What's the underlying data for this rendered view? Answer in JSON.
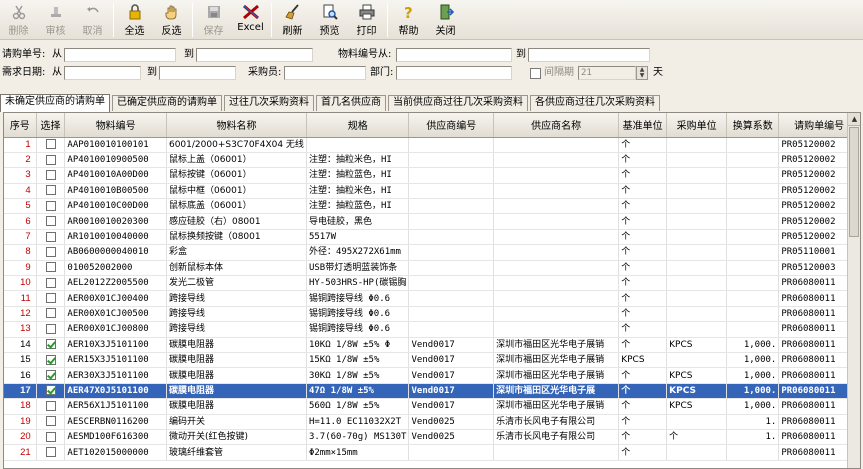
{
  "toolbar": {
    "buttons": [
      {
        "label": "删除",
        "icon": "scissors-icon",
        "enabled": false
      },
      {
        "label": "审核",
        "icon": "stamp-icon",
        "enabled": false
      },
      {
        "label": "取消",
        "icon": "undo-icon",
        "enabled": false
      },
      {
        "label": "全选",
        "icon": "lock-icon",
        "enabled": true
      },
      {
        "label": "反选",
        "icon": "hand-icon",
        "enabled": true
      },
      {
        "label": "保存",
        "icon": "save-icon",
        "enabled": false
      },
      {
        "label": "Excel",
        "icon": "excel-icon",
        "enabled": true
      },
      {
        "label": "刷新",
        "icon": "broom-icon",
        "enabled": true
      },
      {
        "label": "预览",
        "icon": "preview-icon",
        "enabled": true
      },
      {
        "label": "打印",
        "icon": "printer-icon",
        "enabled": true
      },
      {
        "label": "帮助",
        "icon": "help-icon",
        "enabled": true
      },
      {
        "label": "关闭",
        "icon": "exit-icon",
        "enabled": true
      }
    ]
  },
  "filter": {
    "req_no_label": "请购单号:",
    "from_label": "从",
    "to_label": "到",
    "material_no_label": "物料编号从:",
    "material_to_label": "到",
    "need_date_label": "需求日期:",
    "date_from_label": "从",
    "date_to_label": "到",
    "buyer_label": "采购员:",
    "dept_label": "部门:",
    "interval_label": "间隔期",
    "interval_value": "21",
    "days_label": "天"
  },
  "tabs": [
    {
      "label": "未确定供应商的请购单",
      "active": true
    },
    {
      "label": "已确定供应商的请购单",
      "active": false
    },
    {
      "label": "过往几次采购资料",
      "active": false
    },
    {
      "label": "首几名供应商",
      "active": false
    },
    {
      "label": "当前供应商过往几次采购资料",
      "active": false
    },
    {
      "label": "各供应商过往几次采购资料",
      "active": false
    }
  ],
  "grid": {
    "columns": [
      "序号",
      "选择",
      "物料编号",
      "物料名称",
      "规格",
      "供应商编号",
      "供应商名称",
      "基准单位",
      "采购单位",
      "换算系数",
      "请购单编号"
    ],
    "rows": [
      {
        "seq": "1",
        "checked": false,
        "mat_no": "AAP010010100101",
        "mat_name": "6001/2000+S3C70F4X04 无线",
        "spec": "",
        "vendor_no": "",
        "vendor_name": "",
        "base_unit": "个",
        "buy_unit": "",
        "factor": "",
        "req_no": "PR05120002"
      },
      {
        "seq": "2",
        "checked": false,
        "mat_no": "AP4010010900500",
        "mat_name": "鼠标上盖（06001）",
        "spec": "注塑：抽粒米色，HI",
        "vendor_no": "",
        "vendor_name": "",
        "base_unit": "个",
        "buy_unit": "",
        "factor": "",
        "req_no": "PR05120002"
      },
      {
        "seq": "3",
        "checked": false,
        "mat_no": "AP4010010A00D00",
        "mat_name": "鼠标按键（06001）",
        "spec": "注塑：抽粒蓝色，HI",
        "vendor_no": "",
        "vendor_name": "",
        "base_unit": "个",
        "buy_unit": "",
        "factor": "",
        "req_no": "PR05120002"
      },
      {
        "seq": "4",
        "checked": false,
        "mat_no": "AP4010010B00500",
        "mat_name": "鼠标中框（06001）",
        "spec": "注塑：抽粒米色，HI",
        "vendor_no": "",
        "vendor_name": "",
        "base_unit": "个",
        "buy_unit": "",
        "factor": "",
        "req_no": "PR05120002"
      },
      {
        "seq": "5",
        "checked": false,
        "mat_no": "AP4010010C00D00",
        "mat_name": "鼠标底盖（06001）",
        "spec": "注塑：抽粒蓝色，HI",
        "vendor_no": "",
        "vendor_name": "",
        "base_unit": "个",
        "buy_unit": "",
        "factor": "",
        "req_no": "PR05120002"
      },
      {
        "seq": "6",
        "checked": false,
        "mat_no": "AR0010010020300",
        "mat_name": "感应硅胶（右）08001",
        "spec": "导电硅胶，黑色",
        "vendor_no": "",
        "vendor_name": "",
        "base_unit": "个",
        "buy_unit": "",
        "factor": "",
        "req_no": "PR05120002"
      },
      {
        "seq": "7",
        "checked": false,
        "mat_no": "AR1010010040000",
        "mat_name": "鼠标换频按键（08001",
        "spec": "5517W",
        "vendor_no": "",
        "vendor_name": "",
        "base_unit": "个",
        "buy_unit": "",
        "factor": "",
        "req_no": "PR05120002"
      },
      {
        "seq": "8",
        "checked": false,
        "mat_no": "AB0600000040010",
        "mat_name": "彩盒",
        "spec": "外径：495X272X61mm",
        "vendor_no": "",
        "vendor_name": "",
        "base_unit": "个",
        "buy_unit": "",
        "factor": "",
        "req_no": "PR05110001"
      },
      {
        "seq": "9",
        "checked": false,
        "mat_no": "010052002000",
        "mat_name": "创新鼠标本体",
        "spec": "USB带灯透明蓝装饰条",
        "vendor_no": "",
        "vendor_name": "",
        "base_unit": "个",
        "buy_unit": "",
        "factor": "",
        "req_no": "PR05120003"
      },
      {
        "seq": "10",
        "checked": false,
        "mat_no": "AEL2012Z2005500",
        "mat_name": "发光二极管",
        "spec": "HY-503HRS-HP(碳锡胸",
        "vendor_no": "",
        "vendor_name": "",
        "base_unit": "个",
        "buy_unit": "",
        "factor": "",
        "req_no": "PR06080011"
      },
      {
        "seq": "11",
        "checked": false,
        "mat_no": "AER00X01CJ00400",
        "mat_name": "跨接导线",
        "spec": "锡铜跨接导线 Φ0.6",
        "vendor_no": "",
        "vendor_name": "",
        "base_unit": "个",
        "buy_unit": "",
        "factor": "",
        "req_no": "PR06080011"
      },
      {
        "seq": "12",
        "checked": false,
        "mat_no": "AER00X01CJ00500",
        "mat_name": "跨接导线",
        "spec": "锡铜跨接导线 Φ0.6",
        "vendor_no": "",
        "vendor_name": "",
        "base_unit": "个",
        "buy_unit": "",
        "factor": "",
        "req_no": "PR06080011"
      },
      {
        "seq": "13",
        "checked": false,
        "mat_no": "AER00X01CJ00800",
        "mat_name": "跨接导线",
        "spec": "锡铜跨接导线 Φ0.6",
        "vendor_no": "",
        "vendor_name": "",
        "base_unit": "个",
        "buy_unit": "",
        "factor": "",
        "req_no": "PR06080011"
      },
      {
        "seq": "14",
        "checked": true,
        "mat_no": "AER10X3J5101100",
        "mat_name": "碳膜电阻器",
        "spec": "10KΩ  1/8W ±5% Φ",
        "vendor_no": "Vend0017",
        "vendor_name": "深圳市福田区光华电子展销",
        "base_unit": "个",
        "buy_unit": "KPCS",
        "factor": "1,000.",
        "req_no": "PR06080011"
      },
      {
        "seq": "15",
        "checked": true,
        "mat_no": "AER15X3J5101100",
        "mat_name": "碳膜电阻器",
        "spec": "15KΩ  1/8W ±5% ",
        "vendor_no": "Vend0017",
        "vendor_name": "深圳市福田区光华电子展销",
        "base_unit": "KPCS",
        "buy_unit": "",
        "factor": "1,000.",
        "req_no": "PR06080011"
      },
      {
        "seq": "16",
        "checked": true,
        "mat_no": "AER30X3J5101100",
        "mat_name": "碳膜电阻器",
        "spec": "30KΩ  1/8W ±5% ",
        "vendor_no": "Vend0017",
        "vendor_name": "深圳市福田区光华电子展销",
        "base_unit": "个",
        "buy_unit": "KPCS",
        "factor": "1,000.",
        "req_no": "PR06080011"
      },
      {
        "seq": "17",
        "checked": true,
        "mat_no": "AER47X0J5101100",
        "mat_name": "碳膜电阻器",
        "spec": "47Ω  1/8W ±5% ",
        "vendor_no": "Vend0017",
        "vendor_name": "深圳市福田区光华电子展",
        "base_unit": "个",
        "buy_unit": "KPCS",
        "factor": "1,000.",
        "req_no": "PR06080011"
      },
      {
        "seq": "18",
        "checked": false,
        "mat_no": "AER56X1J5101100",
        "mat_name": "碳膜电阻器",
        "spec": "560Ω  1/8W ±5% ",
        "vendor_no": "Vend0017",
        "vendor_name": "深圳市福田区光华电子展销",
        "base_unit": "个",
        "buy_unit": "KPCS",
        "factor": "1,000.",
        "req_no": "PR06080011"
      },
      {
        "seq": "19",
        "checked": false,
        "mat_no": "AESCERBN0116200",
        "mat_name": "编码开关",
        "spec": "H=11.0 EC11032X2T",
        "vendor_no": "Vend0025",
        "vendor_name": "乐清市长风电子有限公司",
        "base_unit": "个",
        "buy_unit": "",
        "factor": "1.",
        "req_no": "PR06080011"
      },
      {
        "seq": "20",
        "checked": false,
        "mat_no": "AESMD100F616300",
        "mat_name": "微动开关(红色按键)",
        "spec": "3.7(60-70g) MS130T",
        "vendor_no": "Vend0025",
        "vendor_name": "乐清市长风电子有限公司",
        "base_unit": "个",
        "buy_unit": "个",
        "factor": "1.",
        "req_no": "PR06080011"
      },
      {
        "seq": "21",
        "checked": false,
        "mat_no": "AET102015000000",
        "mat_name": "玻璃纤维套管",
        "spec": "Φ2mm×15mm",
        "vendor_no": "",
        "vendor_name": "",
        "base_unit": "个",
        "buy_unit": "",
        "factor": "",
        "req_no": "PR06080011"
      }
    ],
    "highlighted_row": 17
  }
}
